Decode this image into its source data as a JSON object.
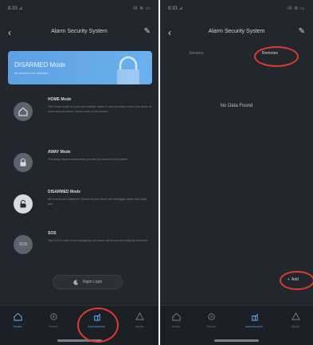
{
  "left": {
    "status": {
      "time": "8:33 ⊿",
      "sys": "ıll ≋ ▭"
    },
    "nav": {
      "back": "‹",
      "title": "Alarm Security System",
      "edit": "✎"
    },
    "mode_card": {
      "name": "DISARMED Mode",
      "desc": "All sensors are disabled"
    },
    "modes": [
      {
        "title": "HOME Mode",
        "body": "The Home mode for your own comfort, alarm & new and alarm when you arrive at home and not alarm. Home mode of the sensor."
      },
      {
        "title": "AWAY Mode",
        "body": "The Away mode is used when you are out and it is set to alarm."
      },
      {
        "title": "DISARMED Mode",
        "body": "All sensors are disarmed. Sensor in your home will not trigger alarm and notify you."
      },
      {
        "title": "SOS",
        "body": "Tap SOS in case of an emergency, the alarm will sound and notify all members."
      }
    ],
    "sos_label": "SOS",
    "night_button": "Night Light",
    "tabs": [
      {
        "label": "Home",
        "active": false
      },
      {
        "label": "Scene",
        "active": false
      },
      {
        "label": "Accessories",
        "active": true
      },
      {
        "label": "Alerts",
        "active": false
      }
    ]
  },
  "right": {
    "status": {
      "time": "8:33 ⊿",
      "sys": "ıll ≋ ▭"
    },
    "nav": {
      "back": "‹",
      "title": "Alarm Security System",
      "edit": "✎"
    },
    "subtabs": [
      {
        "label": "Sensors",
        "active": false
      },
      {
        "label": "Remotes",
        "active": true
      }
    ],
    "empty": "No Data Found",
    "add_label": "Add",
    "add_icon": "+",
    "tabs": [
      {
        "label": "Home",
        "active": false
      },
      {
        "label": "Scene",
        "active": false
      },
      {
        "label": "Accessories",
        "active": true
      },
      {
        "label": "Alerts",
        "active": false
      }
    ]
  },
  "colors": {
    "background": "#22272e",
    "card": "#5ea0e2",
    "annotation": "#e03a2a",
    "accent": "#5aa0e8"
  }
}
